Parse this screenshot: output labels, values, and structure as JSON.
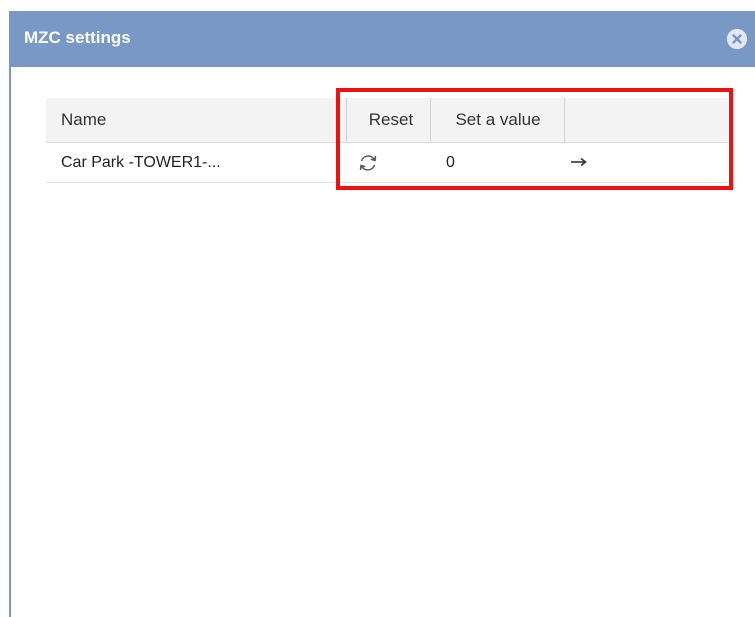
{
  "dialog": {
    "title": "MZC settings",
    "close_icon": "close-circle-icon"
  },
  "grid": {
    "columns": {
      "name": "Name",
      "reset": "Reset",
      "set_value": "Set a value"
    },
    "rows": [
      {
        "name": "Car Park -TOWER1-...",
        "reset_icon": "refresh-icon",
        "value": "0",
        "apply_icon": "arrow-right-icon"
      }
    ]
  },
  "colors": {
    "titlebar": "#7899c5",
    "highlight": "#ee1111",
    "header_bg": "#f3f3f3"
  }
}
